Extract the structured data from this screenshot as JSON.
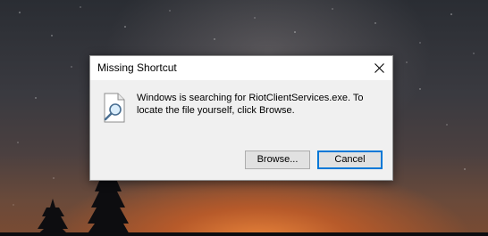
{
  "dialog": {
    "title": "Missing Shortcut",
    "message": "Windows is searching for RiotClientServices.exe. To locate the file yourself, click Browse.",
    "browse_label": "Browse...",
    "cancel_label": "Cancel",
    "icon": "document-search-icon",
    "close_icon": "close-icon",
    "accent_color": "#0078d7"
  }
}
